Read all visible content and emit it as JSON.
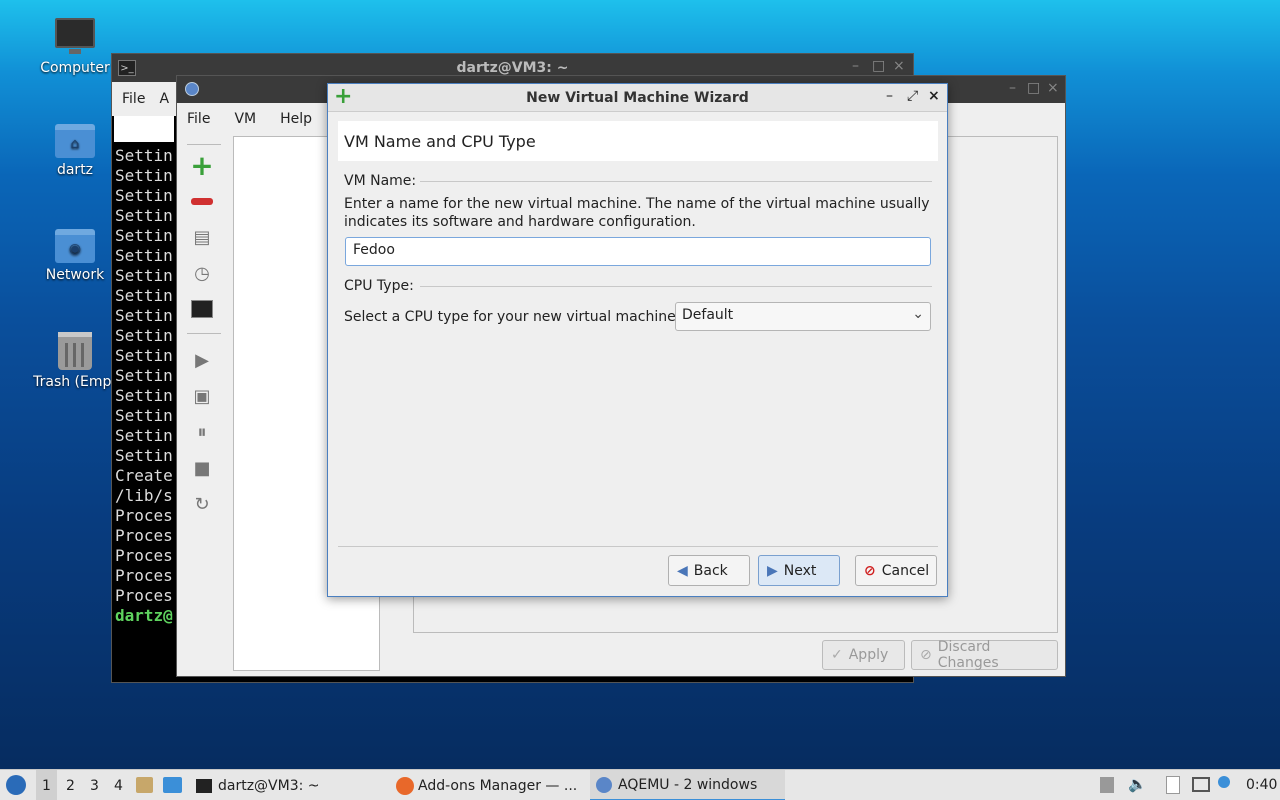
{
  "desktop": {
    "icons": [
      {
        "label": "Computer",
        "icon": "computer-icon"
      },
      {
        "label": "dartz",
        "icon": "home-folder-icon"
      },
      {
        "label": "Network",
        "icon": "network-folder-icon"
      },
      {
        "label": "Trash (Empt",
        "icon": "trash-icon"
      }
    ]
  },
  "terminal": {
    "title": "dartz@VM3: ~",
    "menu": [
      "File",
      "A"
    ],
    "lines": [
      "Settin",
      "Settin",
      "Settin",
      "Settin",
      "Settin",
      "Settin",
      "Settin",
      "Settin",
      "Settin",
      "Settin",
      "Settin",
      "Settin",
      "Settin",
      "Settin",
      "Settin",
      "Settin",
      "Create",
      "/lib/s",
      "Proces",
      "Proces",
      "Proces",
      "Proces",
      "Proces"
    ],
    "prompt": "dartz@"
  },
  "aqemu": {
    "menu": [
      "File",
      "VM",
      "Help"
    ],
    "apply": "Apply",
    "discard": "Discard Changes"
  },
  "wizard": {
    "title": "New Virtual Machine Wizard",
    "page_title": "VM Name and CPU Type",
    "vm_name_group": "VM Name:",
    "vm_name_desc_1": "Enter a name for the new virtual machine. The name of the virtual machine usually",
    "vm_name_desc_2": "indicates its software and hardware configuration.",
    "vm_name_value": "Fedoo",
    "cpu_group": "CPU Type:",
    "cpu_prompt": "Select a CPU type for your new virtual machine:",
    "cpu_selected": "Default",
    "back": "Back",
    "next": "Next",
    "cancel": "Cancel"
  },
  "taskbar": {
    "workspaces": [
      "1",
      "2",
      "3",
      "4"
    ],
    "tasks": [
      "dartz@VM3: ~",
      "Add-ons Manager — ...",
      "AQEMU - 2 windows"
    ],
    "clock": "0:40"
  }
}
